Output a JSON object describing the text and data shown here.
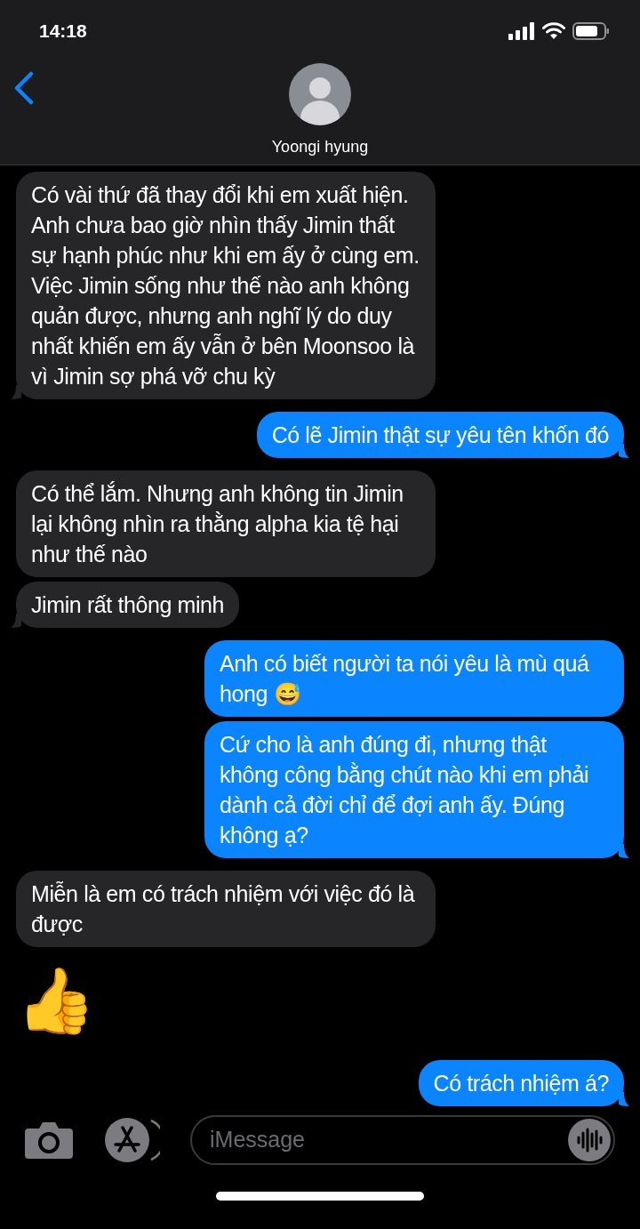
{
  "status_bar": {
    "time": "14:18"
  },
  "contact": {
    "name": "Yoongi hyung"
  },
  "messages": [
    {
      "kind": "received",
      "text": "Có vài thứ đã thay đổi khi em xuất hiện. Anh chưa bao giờ nhìn thấy Jimin thất sự hạnh phúc như khi em ấy ở cùng em. Việc Jimin sống như thế nào anh không quản được, nhưng anh nghĩ lý do duy nhất khiến em ấy vẫn ở bên Moonsoo là vì Jimin sợ phá vỡ chu kỳ",
      "tail": true
    },
    {
      "kind": "sent",
      "text": "Có lẽ Jimin thật sự yêu tên khốn đó",
      "tail": true
    },
    {
      "kind": "received",
      "text": "Có thể lắm. Nhưng anh không tin Jimin lại không nhìn ra thằng alpha kia tệ hại như thế nào",
      "tail": false
    },
    {
      "kind": "received",
      "text": "Jimin rất thông minh",
      "tail": true
    },
    {
      "kind": "sent",
      "text": "Anh có biết người ta nói yêu là mù quá hong 😅",
      "tail": false
    },
    {
      "kind": "sent",
      "text": "Cứ cho là anh đúng đi, nhưng thật không công bằng chút nào khi em phải dành cả đời chỉ để đợi anh ấy. Đúng không ạ?",
      "tail": true
    },
    {
      "kind": "received",
      "text": "Miễn là em có trách nhiệm với việc đó là được",
      "tail": false
    },
    {
      "kind": "emoji",
      "text": "👍"
    },
    {
      "kind": "sent",
      "text": "Có trách nhiệm á?",
      "tail": true
    }
  ],
  "composer": {
    "placeholder": "iMessage"
  }
}
